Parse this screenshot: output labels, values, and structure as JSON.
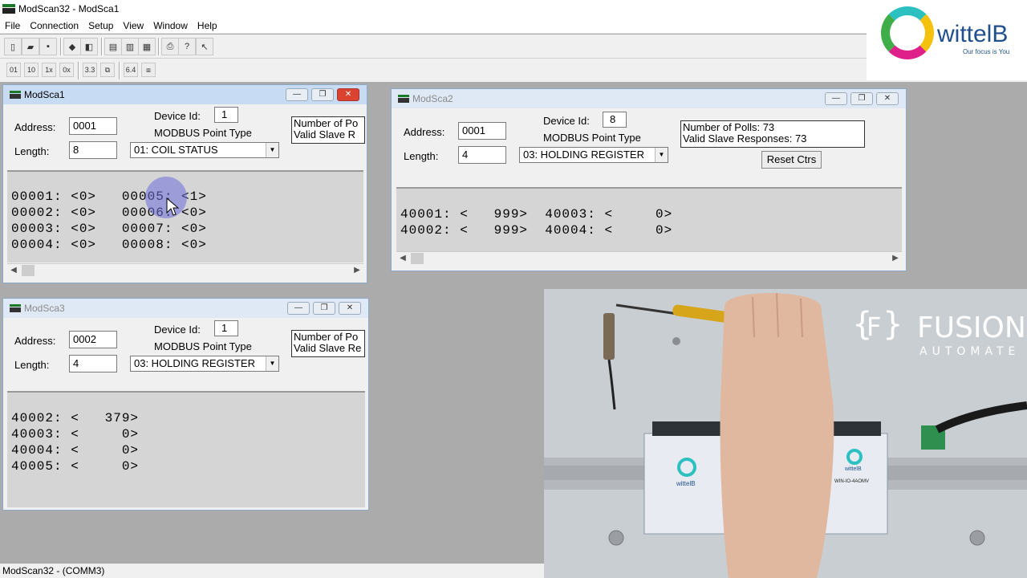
{
  "app": {
    "title": "ModScan32 - ModSca1"
  },
  "menu": [
    "File",
    "Connection",
    "Setup",
    "View",
    "Window",
    "Help"
  ],
  "window_controls": {
    "minimize": "—",
    "restore": "❐",
    "close": "✕"
  },
  "logo": {
    "brand": "wittelB",
    "tagline": "Our focus is You"
  },
  "windows": {
    "modsca1": {
      "title": "ModSca1",
      "address_label": "Address:",
      "address": "0001",
      "length_label": "Length:",
      "length": "8",
      "device_label": "Device Id:",
      "device_id": "1",
      "point_type_label": "MODBUS Point Type",
      "point_type": "01: COIL STATUS",
      "polls_line1": "Number of Po",
      "polls_line2": "Valid Slave R",
      "rows": [
        "00001: <0>   00005: <1>",
        "00002: <0>   00006: <0>",
        "00003: <0>   00007: <0>",
        "00004: <0>   00008: <0>"
      ]
    },
    "modsca2": {
      "title": "ModSca2",
      "address_label": "Address:",
      "address": "0001",
      "length_label": "Length:",
      "length": "4",
      "device_label": "Device Id:",
      "device_id": "8",
      "point_type_label": "MODBUS Point Type",
      "point_type": "03: HOLDING REGISTER",
      "polls_line1": "Number of Polls: 73",
      "polls_line2": "Valid Slave Responses: 73",
      "reset_label": "Reset Ctrs",
      "rows": [
        "40001: <   999>  40003: <     0>",
        "40002: <   999>  40004: <     0>"
      ]
    },
    "modsca3": {
      "title": "ModSca3",
      "address_label": "Address:",
      "address": "0002",
      "length_label": "Length:",
      "length": "4",
      "device_label": "Device Id:",
      "device_id": "1",
      "point_type_label": "MODBUS Point Type",
      "point_type": "03: HOLDING REGISTER",
      "polls_line1": "Number of Po",
      "polls_line2": "Valid Slave Re",
      "rows": [
        "40002: <   379>",
        "40003: <     0>",
        "40004: <     0>",
        "40005: <     0>"
      ]
    }
  },
  "status": {
    "text": "ModScan32 - (COMM3)"
  },
  "video_overlay": {
    "logo_text": "FUSION",
    "logo_sub": "AUTOMATE",
    "device_brand": "wittelB",
    "module_label": "WIN-IO-4AOMV"
  }
}
